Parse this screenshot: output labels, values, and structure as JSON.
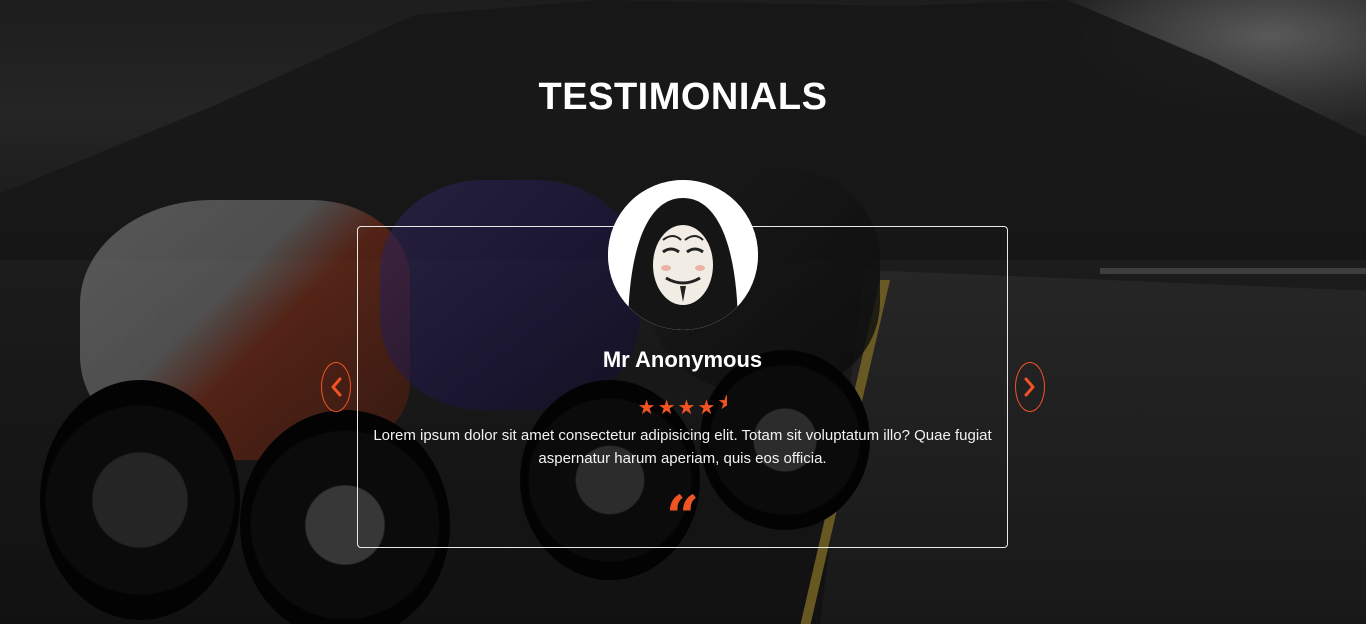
{
  "section": {
    "title": "TESTIMONIALS"
  },
  "testimonial": {
    "name": "Mr Anonymous",
    "rating": 4.5,
    "rating_max": 5,
    "text": "Lorem ipsum dolor sit amet consectetur adipisicing elit. Totam sit voluptatum illo? Quae fugiat aspernatur harum aperiam, quis eos officia.",
    "quote_glyph": "“"
  },
  "icons": {
    "prev": "chevron-left-icon",
    "next": "chevron-right-icon",
    "star": "star-icon",
    "quote": "quote-icon"
  },
  "colors": {
    "accent": "#f05423",
    "text": "#ffffff"
  }
}
